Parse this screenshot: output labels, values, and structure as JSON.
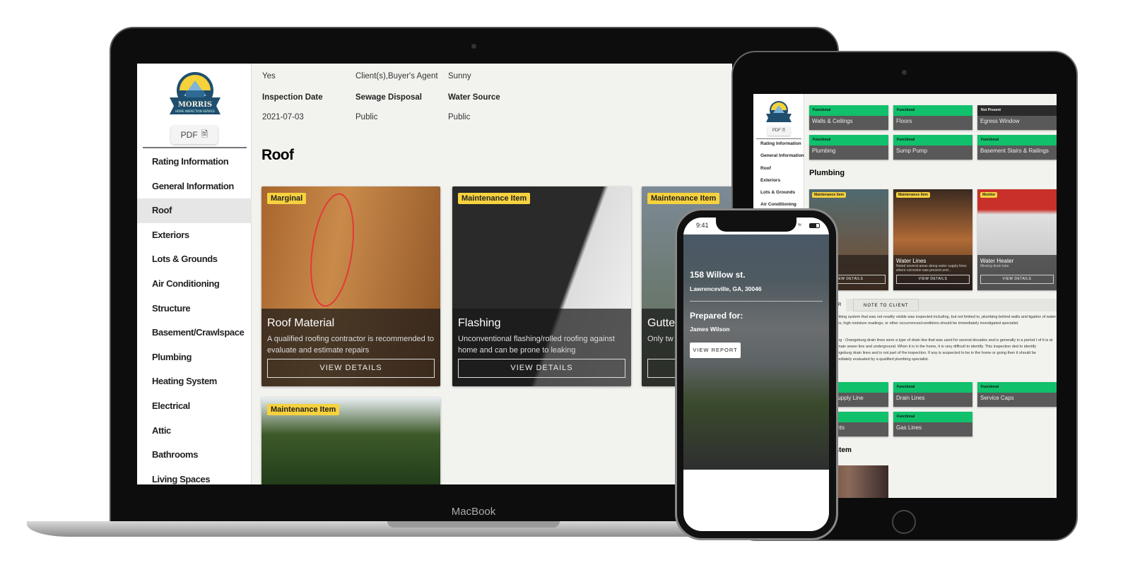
{
  "laptop": {
    "brand_label": "MacBook",
    "sidebar": {
      "logo_text": "MORRIS",
      "logo_subtext": "HOME INSPECTION SERVICE",
      "pdf_label": "PDF",
      "items": [
        {
          "label": "Rating Information"
        },
        {
          "label": "General Information"
        },
        {
          "label": "Roof",
          "active": true
        },
        {
          "label": "Exteriors"
        },
        {
          "label": "Lots & Grounds"
        },
        {
          "label": "Air Conditioning"
        },
        {
          "label": "Structure"
        },
        {
          "label": "Basement/Crawlspace"
        },
        {
          "label": "Plumbing"
        },
        {
          "label": "Heating System"
        },
        {
          "label": "Electrical"
        },
        {
          "label": "Attic"
        },
        {
          "label": "Bathrooms"
        },
        {
          "label": "Living Spaces"
        }
      ]
    },
    "info": {
      "row1": [
        "Yes",
        "Client(s),Buyer's Agent",
        "Sunny"
      ],
      "headers": [
        "Inspection Date",
        "Sewage Disposal",
        "Water Source"
      ],
      "values": [
        "2021-07-03",
        "Public",
        "Public"
      ]
    },
    "section_title": "Roof",
    "cards": [
      {
        "badge": "Marginal",
        "title": "Roof Material",
        "desc": "A qualified roofing contractor is recommended to evaluate and estimate repairs",
        "button": "VIEW DETAILS"
      },
      {
        "badge": "Maintenance Item",
        "title": "Flashing",
        "desc": "Unconventional flashing/rolled roofing against home and can be prone to leaking",
        "button": "VIEW DETAILS"
      },
      {
        "badge": "Maintenance Item",
        "title": "Gutte",
        "desc": "Only tw which d",
        "button": "VIEW DETAILS"
      },
      {
        "badge": "Maintenance Item"
      }
    ],
    "colors": {
      "badge": "#f7d23e",
      "background": "#f2f2ee"
    }
  },
  "tablet": {
    "sidebar": {
      "pdf_label": "PDF",
      "items": [
        "Rating Information",
        "General Information",
        "Roof",
        "Exteriors",
        "Lots & Grounds",
        "Air Conditioning"
      ]
    },
    "tiles_top": [
      {
        "status": "Functional",
        "name": "Walls & Ceilings"
      },
      {
        "status": "Functional",
        "name": "Floors"
      },
      {
        "status": "Not Present",
        "name": "Egress Window"
      },
      {
        "status": "Functional",
        "name": "Plumbing"
      },
      {
        "status": "Functional",
        "name": "Sump Pump"
      },
      {
        "status": "Functional",
        "name": "Basement Stairs & Railings"
      }
    ],
    "section_title": "Plumbing",
    "cards": [
      {
        "badge": "Maintenance Item",
        "title": "r Shutoff",
        "desc": "n basement",
        "button": "VIEW DETAILS"
      },
      {
        "badge": "Maintenance Item",
        "title": "Water Lines",
        "desc": "Noted several areas along water supply lines where corrosion was present and...",
        "button": "VIEW DETAILS"
      },
      {
        "badge": "Monitor",
        "title": "Water Heater",
        "desc": "Missing drain tube",
        "button": "VIEW DETAILS"
      }
    ],
    "tabs": [
      "ER",
      "NOTE TO CLIENT"
    ],
    "notes": [
      "plumbing system that was not readily visible was inspected including, but not limited to, plumbing behind walls and tigation of water stains, high moisture readings, or other occurrences/conditions should be immediately investigated specialist.",
      "Piping - Orangeburg drain lines were a type of drain line that was used for several decades and is generally in a period t of it is at the main sewer line and underground. When it is in the home, it is very difficult to identify. This inspection ded to identify Orangeburg drain lines and is not part of the inspection. If any is suspected to be in the home or going then it should be immediately evaluated by a qualified plumbing specialist."
    ],
    "tiles_bottom": [
      {
        "status": "",
        "name": "r Supply Line"
      },
      {
        "status": "Functional",
        "name": "Drain Lines"
      },
      {
        "status": "Functional",
        "name": "Service Caps"
      },
      {
        "status": "",
        "name": "Vents"
      },
      {
        "status": "Functional",
        "name": "Gas Lines"
      }
    ],
    "section2_title": "ystem",
    "colors": {
      "functional": "#10c06b",
      "not_present": "#2b2b2b",
      "tile": "#595959"
    }
  },
  "phone": {
    "time": "9:41",
    "address": "158 Willow st.",
    "city": "Lawrenceville, GA, 30046",
    "prepared_label": "Prepared for:",
    "client": "James Wilson",
    "button": "VIEW REPORT"
  }
}
